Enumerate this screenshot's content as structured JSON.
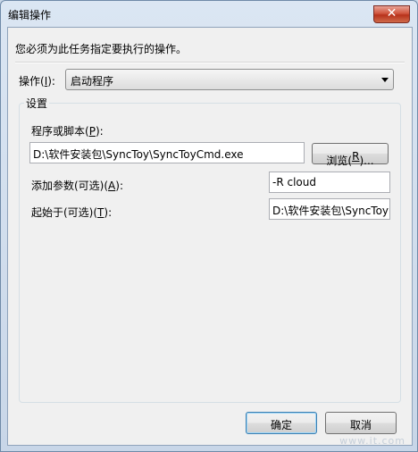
{
  "window": {
    "title": "编辑操作",
    "close_glyph": "✕"
  },
  "instruction": "您必须为此任务指定要执行的操作。",
  "action": {
    "label_pre": "操作(",
    "label_key": "I",
    "label_post": "):",
    "value": "启动程序"
  },
  "settings": {
    "title": "设置",
    "program": {
      "label_pre": "程序或脚本(",
      "label_key": "P",
      "label_post": "):",
      "value": "D:\\软件安装包\\SyncToy\\SyncToyCmd.exe"
    },
    "browse": {
      "label_pre": "浏览(",
      "label_key": "R",
      "label_post": ")..."
    },
    "args": {
      "label_pre": "添加参数(可选)(",
      "label_key": "A",
      "label_post": "):",
      "value": "-R cloud"
    },
    "start_in": {
      "label_pre": "起始于(可选)(",
      "label_key": "T",
      "label_post": "):",
      "value": "D:\\软件安装包\\SyncToy"
    }
  },
  "buttons": {
    "ok": "确定",
    "cancel": "取消"
  },
  "watermark": "www.it.com"
}
